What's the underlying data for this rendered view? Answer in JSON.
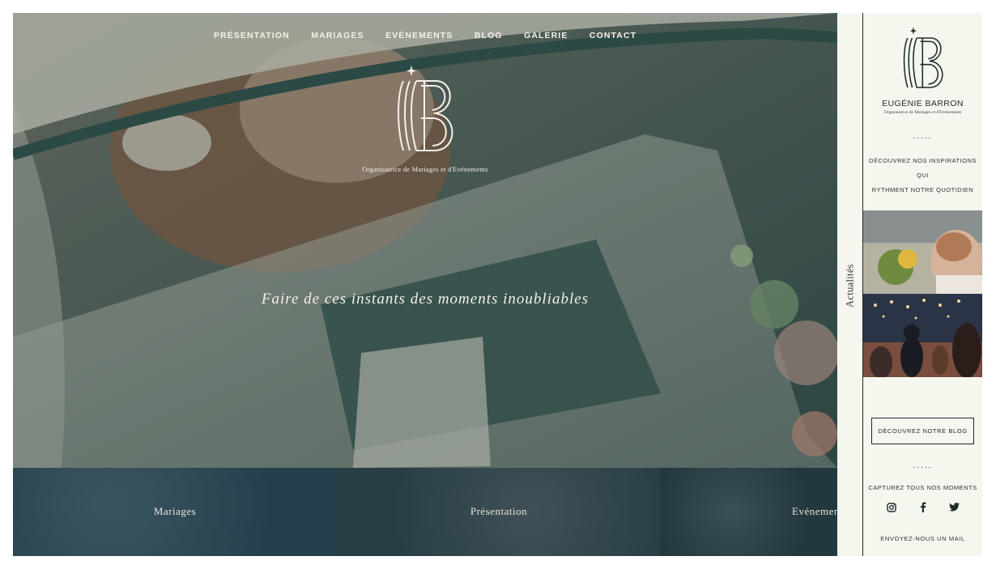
{
  "nav": {
    "items": [
      "PRÉSENTATION",
      "MARIAGES",
      "EVÉNEMENTS",
      "BLOG",
      "GALERIE",
      "CONTACT"
    ]
  },
  "hero": {
    "logo_subtitle": "Organisatrice de Mariages et d'Evénements",
    "tagline": "Faire de ces instants des moments inoubliables"
  },
  "tiles": [
    {
      "label": "Mariages"
    },
    {
      "label": "Présentation"
    },
    {
      "label": "Evénements"
    }
  ],
  "vertical_tab": {
    "label": "Actualités"
  },
  "sidebar": {
    "brand_name": "EUGÉNIE BARRON",
    "brand_subtitle": "Organisatrice de Mariages et d'Evénements",
    "dots": ".....",
    "discover_line1": "DÉCOUVREZ NOS INSPIRATIONS QUI",
    "discover_line2": "RYTHMENT NOTRE QUOTIDIEN",
    "blog_button": "DÉCOUVREZ NOTRE BLOG",
    "capture_text": "CAPTUREZ TOUS NOS MOMENTS",
    "mail_link": "ENVOYEZ-NOUS UN MAIL",
    "social_icons": [
      "instagram-icon",
      "facebook-icon",
      "twitter-icon"
    ]
  },
  "colors": {
    "sidebar_bg": "#f5f7ef",
    "hero_overlay": "#2f4744",
    "tile_bg": "#24404c",
    "text_light": "#f3f1ea",
    "text_dark": "#1f2b2b"
  }
}
